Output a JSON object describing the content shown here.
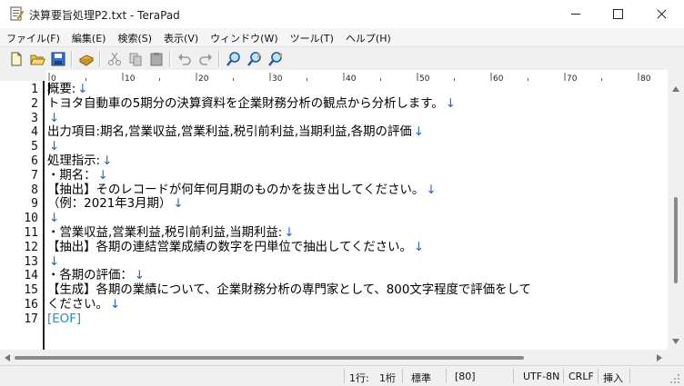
{
  "window": {
    "title": "決算要旨処理P2.txt - TeraPad"
  },
  "menu": [
    {
      "label": "ファイル(F)"
    },
    {
      "label": "編集(E)"
    },
    {
      "label": "検索(S)"
    },
    {
      "label": "表示(V)"
    },
    {
      "label": "ウィンドウ(W)"
    },
    {
      "label": "ツール(T)"
    },
    {
      "label": "ヘルプ(H)"
    }
  ],
  "toolbar": [
    {
      "name": "new-file-icon"
    },
    {
      "name": "open-folder-icon"
    },
    {
      "name": "save-icon"
    },
    {
      "name": "print-icon"
    },
    {
      "name": "cut-icon"
    },
    {
      "name": "copy-icon"
    },
    {
      "name": "paste-icon"
    },
    {
      "name": "undo-icon"
    },
    {
      "name": "redo-icon"
    },
    {
      "name": "find-icon"
    },
    {
      "name": "find-next-icon"
    },
    {
      "name": "find-prev-icon"
    }
  ],
  "ruler": {
    "labels": [
      "0",
      "10",
      "20",
      "30",
      "40",
      "50",
      "60",
      "70",
      "80"
    ]
  },
  "editor": {
    "line_numbers": [
      "1",
      "2",
      "3",
      "4",
      "5",
      "6",
      "7",
      "8",
      "9",
      "10",
      "11",
      "12",
      "13",
      "14",
      "15",
      "16",
      "17"
    ],
    "lines": [
      {
        "text": "概要:",
        "nl": "↓"
      },
      {
        "text": "トヨタ自動車の5期分の決算資料を企業財務分析の観点から分析します。",
        "nl": "↓"
      },
      {
        "text": "",
        "nl": "↓"
      },
      {
        "text": "出力項目:期名,営業収益,営業利益,税引前利益,当期利益,各期の評価",
        "nl": "↓"
      },
      {
        "text": "",
        "nl": "↓"
      },
      {
        "text": "処理指示:",
        "nl": "↓"
      },
      {
        "text": "・期名：",
        "nl": "↓"
      },
      {
        "text": "【抽出】そのレコードが何年何月期のものかを抜き出してください。",
        "nl": "↓"
      },
      {
        "text": "（例：2021年3月期）",
        "nl": "↓"
      },
      {
        "text": "",
        "nl": "↓"
      },
      {
        "text": "・営業収益,営業利益,税引前利益,当期利益:",
        "nl": "↓"
      },
      {
        "text": "【抽出】各期の連結営業成績の数字を円単位で抽出してください。",
        "nl": "↓"
      },
      {
        "text": "",
        "nl": "↓"
      },
      {
        "text": "・各期の評価：",
        "nl": "↓"
      },
      {
        "text": "【生成】各期の業績について、企業財務分析の専門家として、800文字程度で評価をして",
        "nl": ""
      },
      {
        "text": "ください。",
        "nl": "↓"
      },
      {
        "text": "[EOF]",
        "nl": ""
      }
    ]
  },
  "status": {
    "line": "1行:",
    "column": "1桁",
    "mode": "標準",
    "code": "[80]",
    "encoding": "UTF-8N",
    "newline": "CRLF",
    "insert": "挿入"
  }
}
